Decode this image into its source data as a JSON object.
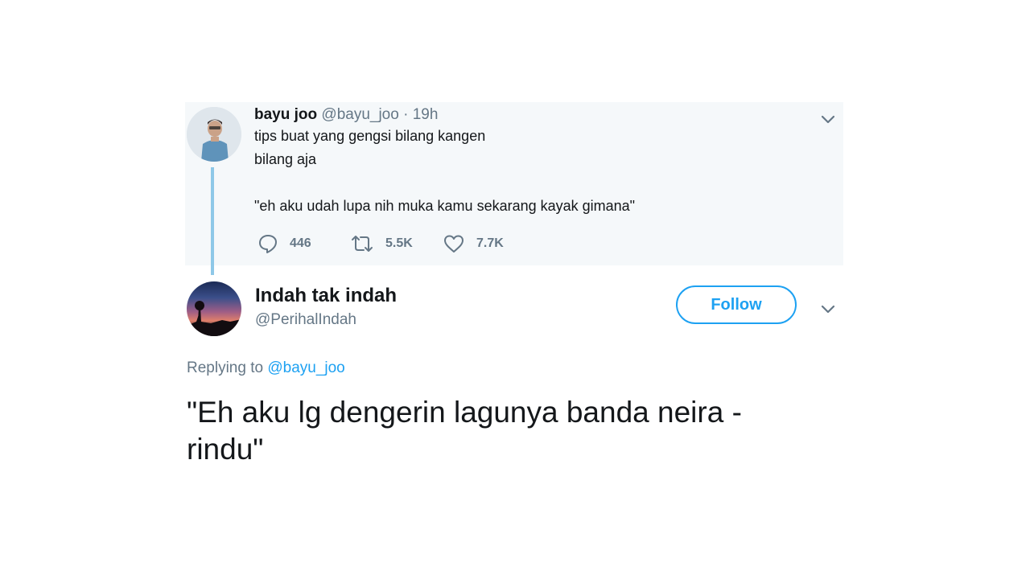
{
  "parent_tweet": {
    "name": "bayu joo",
    "handle": "@bayu_joo",
    "separator": "·",
    "time": "19h",
    "lines": [
      "tips buat yang gengsi bilang kangen",
      "bilang aja",
      "\"eh aku udah lupa nih muka kamu sekarang kayak gimana\""
    ],
    "replies": "446",
    "retweets": "5.5K",
    "likes": "7.7K"
  },
  "reply_tweet": {
    "name": "Indah tak indah",
    "handle": "@PerihalIndah",
    "follow_label": "Follow",
    "replying_prefix": "Replying to",
    "replying_to": "@bayu_joo",
    "text_lines": [
      "\"Eh aku lg dengerin lagunya banda neira -",
      "rindu\""
    ]
  },
  "colors": {
    "accent": "#1da1f2",
    "muted": "#657786",
    "thread_line": "#8ec8e8",
    "parent_bg": "#f5f8fa"
  },
  "icons": [
    "chevron-down-icon",
    "reply-icon",
    "retweet-icon",
    "like-icon"
  ]
}
